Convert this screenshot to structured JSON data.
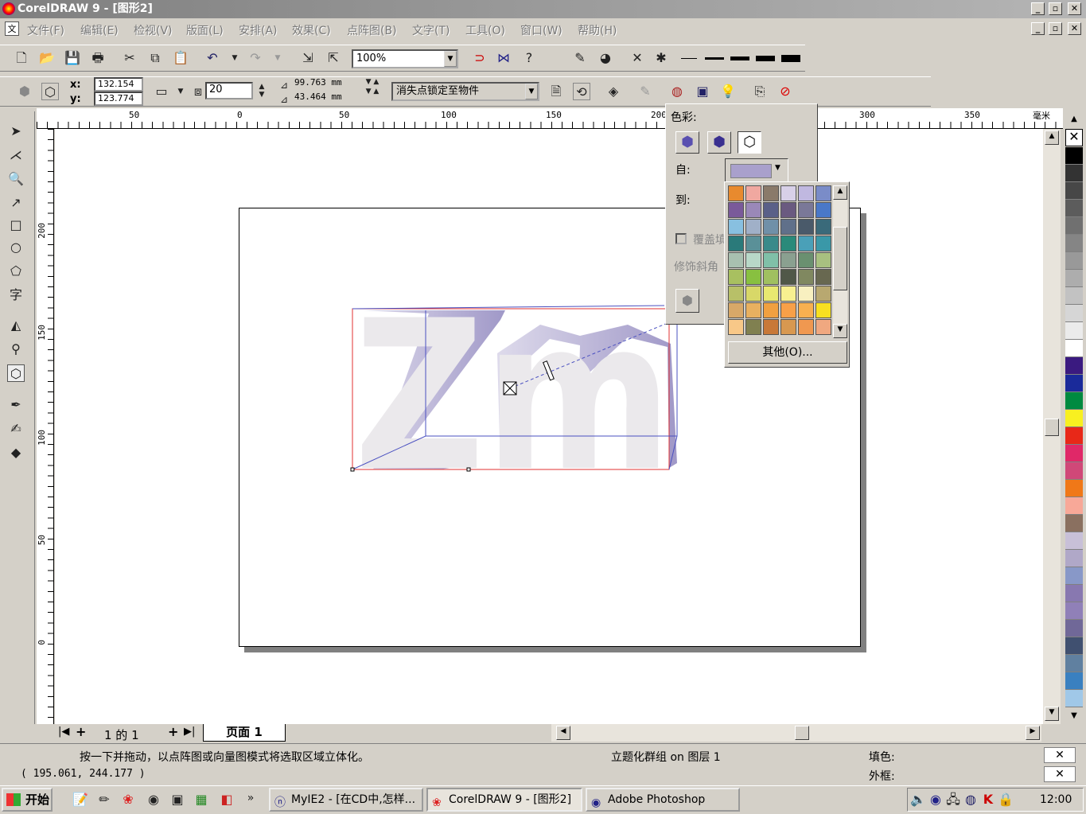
{
  "window": {
    "title": "CorelDRAW 9 - [图形2]"
  },
  "menu": [
    "文件(F)",
    "编辑(E)",
    "检视(V)",
    "版面(L)",
    "安排(A)",
    "效果(C)",
    "点阵图(B)",
    "文字(T)",
    "工具(O)",
    "窗口(W)",
    "帮助(H)"
  ],
  "toolbar": {
    "zoom": "100%"
  },
  "propbar": {
    "x_label": "x:",
    "y_label": "y:",
    "x": "132.154",
    "y": "123.774",
    "depth": "20",
    "vp_x": "99.763",
    "vp_y": "43.464",
    "unit": "mm",
    "vp_lock": "消失点锁定至物件"
  },
  "ruler": {
    "unit": "毫米",
    "h_ticks": [
      "50",
      "0",
      "50",
      "100",
      "150",
      "200",
      "300",
      "350"
    ],
    "v_ticks": [
      "200",
      "150",
      "100",
      "50",
      "0"
    ]
  },
  "popup": {
    "title": "色彩:",
    "from": "自:",
    "to": "到:",
    "overlay": "覆盖填",
    "bevel": "修饰斜角",
    "other": "其他(O)...",
    "from_color": "#a9a0cc"
  },
  "colorgrid": [
    "#e88a2e",
    "#f0a8a0",
    "#8a7a6a",
    "#d8d0e8",
    "#c0b8e0",
    "#7a8cc8",
    "#7a5a9a",
    "#9a88b8",
    "#5a6088",
    "#6a5a80",
    "#7a7898",
    "#4a78c8",
    "#88c0e0",
    "#a0b0c8",
    "#7090a8",
    "#60708a",
    "#4a5a6a",
    "#3a6a7a",
    "#2a7a7a",
    "#5a9098",
    "#3a8a8a",
    "#2a8a7a",
    "#4aa0b8",
    "#3a98a8",
    "#a8c0b0",
    "#b8d8c8",
    "#80c0a8",
    "#8aa090",
    "#6a9070",
    "#a8c080",
    "#a8c060",
    "#88c040",
    "#a0c060",
    "#505848",
    "#808860",
    "#686850",
    "#b8c068",
    "#d8d868",
    "#e8e870",
    "#f8f090",
    "#f8f0c0",
    "#b8a870",
    "#d8a868",
    "#e8b060",
    "#f0a040",
    "#f8a048",
    "#f8b050",
    "#f8e020",
    "#f8c888",
    "#808050",
    "#c87838",
    "#d89850",
    "#f09850",
    "#f0a880"
  ],
  "palette": [
    "#000000",
    "#333333",
    "#474747",
    "#5c5c5c",
    "#707070",
    "#858585",
    "#999999",
    "#adadad",
    "#c2c2c2",
    "#d6d6d6",
    "#ebebeb",
    "#ffffff",
    "#3a1a80",
    "#1a2a9a",
    "#008a40",
    "#f8f020",
    "#e82818",
    "#e02868",
    "#d04878",
    "#f07818",
    "#f8a898",
    "#8a7060",
    "#c8c0d8",
    "#b0a8c8",
    "#8898c8",
    "#8878b0",
    "#9080b8",
    "#706898",
    "#405070",
    "#6080a0",
    "#3a80c0",
    "#a0c8e8"
  ],
  "tabs": {
    "page_count": "1 的 1",
    "page_tab": "页面  1"
  },
  "status": {
    "hint": "按一下并拖动，以点阵图或向量图模式将选取区域立体化。",
    "coords": "( 195.061, 244.177 )",
    "object": "立题化群组 on 图层 1",
    "fill": "填色:",
    "outline": "外框:"
  },
  "taskbar": {
    "start": "开始",
    "items": [
      "MyIE2 - [在CD中,怎样...",
      "CorelDRAW 9 - [图形2]",
      "Adobe Photoshop"
    ],
    "clock": "12:00"
  },
  "art": {
    "text": "Zm"
  }
}
